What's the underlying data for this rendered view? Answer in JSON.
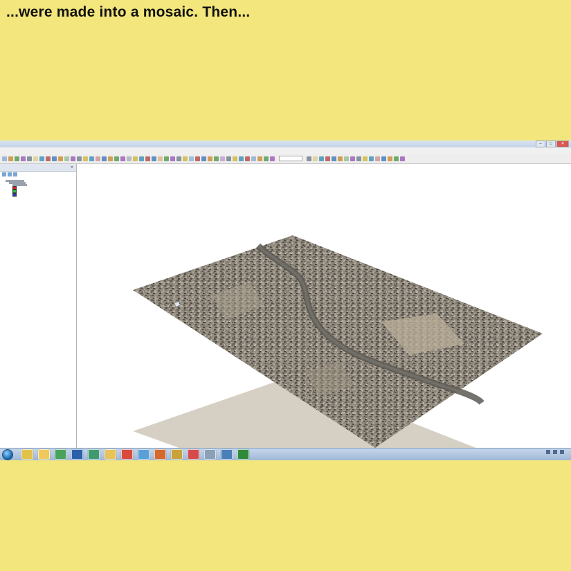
{
  "caption": "...were made into a mosaic. Then...",
  "window": {
    "title": "",
    "buttons": [
      "minimize",
      "maximize",
      "close"
    ]
  },
  "menubar": {
    "items": []
  },
  "toolbar": {
    "icon_colors": [
      "#3f76b8",
      "#c98a2f",
      "#4d9a4a",
      "#9b59b6",
      "#6c7a89",
      "#d1b43a",
      "#3a8fb7",
      "#b34747"
    ]
  },
  "toc": {
    "title": "",
    "tree": [
      {
        "indent": 1,
        "label": "",
        "swatch": null
      },
      {
        "indent": 2,
        "label": "",
        "swatch": null
      },
      {
        "indent": 3,
        "label": "",
        "swatch": null
      },
      {
        "indent": 3,
        "label": "",
        "swatch": "#e02020"
      },
      {
        "indent": 3,
        "label": "",
        "swatch": "#2ecc40"
      },
      {
        "indent": 3,
        "label": "",
        "swatch": "#1f3fbf"
      }
    ]
  },
  "scene": {
    "content": "3d-aerial-mosaic",
    "ground_color": "#f2e67d"
  },
  "taskbar": {
    "apps": [
      "explorer",
      "folder",
      "chrome",
      "word",
      "photos",
      "folder",
      "chrome",
      "notes",
      "powerpoint",
      "arcmap",
      "paint",
      "settings",
      "tools",
      "globe"
    ],
    "app_colors": [
      "#e2c24a",
      "#f0c95a",
      "#4aa35a",
      "#2b5fab",
      "#3f9b6e",
      "#e8c35a",
      "#d94b3d",
      "#5aa0d8",
      "#d5682c",
      "#c9a23b",
      "#d84a4a",
      "#8aa0b8",
      "#4a7fb8",
      "#2f8a3a"
    ],
    "clock": ""
  }
}
